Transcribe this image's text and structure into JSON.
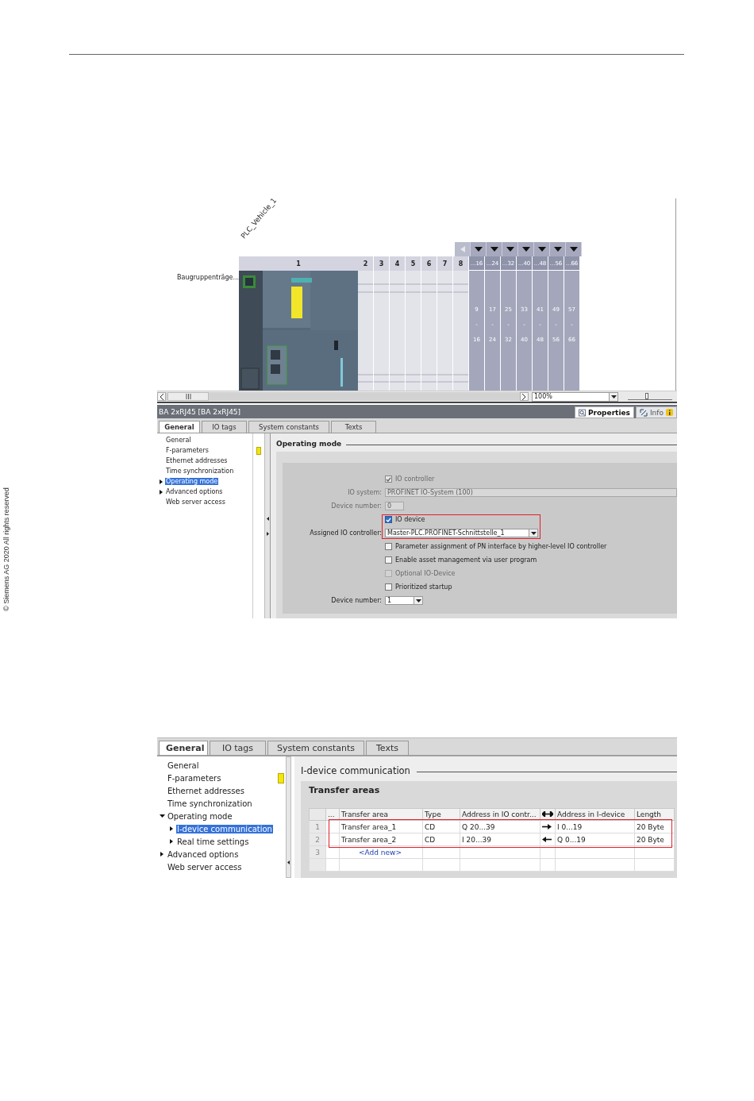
{
  "side_note": "© Siemens AG 2020 All rights reserved",
  "figure_1": {
    "device_view": {
      "device_name": "PLC_Vehicle_1",
      "rack_label": "Baugruppenträge...",
      "slots": [
        "1",
        "2",
        "3",
        "4",
        "5",
        "6",
        "7",
        "8"
      ],
      "extension_columns": [
        {
          "header": "...16",
          "first": "9",
          "separator": "-",
          "last": "16"
        },
        {
          "header": "...24",
          "first": "17",
          "separator": "-",
          "last": "24"
        },
        {
          "header": "...32",
          "first": "25",
          "separator": "-",
          "last": "32"
        },
        {
          "header": "...40",
          "first": "33",
          "separator": "-",
          "last": "40"
        },
        {
          "header": "...48",
          "first": "41",
          "separator": "-",
          "last": "48"
        },
        {
          "header": "...56",
          "first": "49",
          "separator": "-",
          "last": "56"
        },
        {
          "header": "...66",
          "first": "57",
          "separator": "-",
          "last": "66"
        }
      ],
      "zoom": "100%",
      "zoom_slider": {
        "level": 0.42
      }
    },
    "properties": {
      "title": "BA 2xRJ45 [BA 2xRJ45]",
      "inspector_tabs": [
        {
          "label": "Properties",
          "selected": true
        },
        {
          "label": "Info",
          "selected": false
        }
      ],
      "tabs": [
        {
          "label": "General",
          "selected": true
        },
        {
          "label": "IO tags",
          "selected": false
        },
        {
          "label": "System constants",
          "selected": false
        },
        {
          "label": "Texts",
          "selected": false
        }
      ],
      "nav": [
        {
          "label": "General",
          "selected": false,
          "expandable": false,
          "warning": false
        },
        {
          "label": "F-parameters",
          "selected": false,
          "expandable": false,
          "warning": true
        },
        {
          "label": "Ethernet addresses",
          "selected": false,
          "expandable": false,
          "warning": false
        },
        {
          "label": "Time synchronization",
          "selected": false,
          "expandable": false,
          "warning": false
        },
        {
          "label": "Operating mode",
          "selected": true,
          "expandable": true,
          "expanded": false,
          "warning": false
        },
        {
          "label": "Advanced options",
          "selected": false,
          "expandable": true,
          "expanded": false,
          "warning": false
        },
        {
          "label": "Web server access",
          "selected": false,
          "expandable": false,
          "warning": false
        }
      ],
      "section_title": "Operating mode",
      "fields": [
        {
          "kind": "checkbox",
          "label": "IO controller",
          "checked": true,
          "disabled": true,
          "highlighted": false
        },
        {
          "kind": "wide_field",
          "label": "IO system:",
          "value": "PROFINET IO-System (100)",
          "disabled": true,
          "highlighted": false
        },
        {
          "kind": "short_field",
          "label": "Device number:",
          "value": "0",
          "disabled": true,
          "highlighted": false
        },
        {
          "kind": "checkbox",
          "label": "IO device",
          "checked": true,
          "disabled": false,
          "highlighted": true
        },
        {
          "kind": "dropdown",
          "label": "Assigned IO controller:",
          "value": "Master-PLC.PROFINET-Schnittstelle_1",
          "disabled": false,
          "highlighted": true
        },
        {
          "kind": "checkbox",
          "label": "Parameter assignment of PN interface by higher-level IO controller",
          "checked": false,
          "disabled": false,
          "highlighted": false
        },
        {
          "kind": "checkbox",
          "label": "Enable asset management via user program",
          "checked": false,
          "disabled": false,
          "highlighted": false
        },
        {
          "kind": "checkbox",
          "label": "Optional IO-Device",
          "checked": false,
          "disabled": true,
          "highlighted": false
        },
        {
          "kind": "checkbox",
          "label": "Prioritized startup",
          "checked": false,
          "disabled": false,
          "highlighted": false
        },
        {
          "kind": "short_dropdown",
          "label": "Device number:",
          "value": "1",
          "disabled": false,
          "highlighted": false
        }
      ]
    }
  },
  "figure_2": {
    "tabs": [
      {
        "label": "General",
        "selected": true
      },
      {
        "label": "IO tags",
        "selected": false
      },
      {
        "label": "System constants",
        "selected": false
      },
      {
        "label": "Texts",
        "selected": false
      }
    ],
    "nav": [
      {
        "label": "General",
        "selected": false,
        "expandable": false,
        "warning": false
      },
      {
        "label": "F-parameters",
        "selected": false,
        "expandable": false,
        "warning": true
      },
      {
        "label": "Ethernet addresses",
        "selected": false,
        "expandable": false,
        "warning": false
      },
      {
        "label": "Time synchronization",
        "selected": false,
        "expandable": false,
        "warning": false
      },
      {
        "label": "Operating mode",
        "selected": false,
        "expandable": true,
        "expanded": true,
        "warning": false,
        "children": [
          {
            "label": "I-device communication",
            "selected": true,
            "expandable": true,
            "expanded": false,
            "warning": false
          },
          {
            "label": "Real time settings",
            "selected": false,
            "expandable": true,
            "expanded": false,
            "warning": false
          }
        ]
      },
      {
        "label": "Advanced options",
        "selected": false,
        "expandable": true,
        "expanded": false,
        "warning": false
      },
      {
        "label": "Web server access",
        "selected": false,
        "expandable": false,
        "warning": false
      }
    ],
    "section_title": "I-device communication",
    "panel_title": "Transfer areas",
    "table": {
      "columns": [
        {
          "kind": "text",
          "label": "..."
        },
        {
          "kind": "text",
          "label": "Transfer area"
        },
        {
          "kind": "text",
          "label": "Type"
        },
        {
          "kind": "text",
          "label": "Address in IO contr..."
        },
        {
          "kind": "direction"
        },
        {
          "kind": "text",
          "label": "Address in I-device"
        },
        {
          "kind": "text",
          "label": "Length"
        }
      ],
      "rows": [
        {
          "kind": "area",
          "number": "1",
          "name": "Transfer area_1",
          "type": "CD",
          "io_address": "Q 20...39",
          "to_device": true,
          "device_address": "I 0...19",
          "length": "20 Byte",
          "highlighted": true
        },
        {
          "kind": "area",
          "number": "2",
          "name": "Transfer area_2",
          "type": "CD",
          "io_address": "I 20...39",
          "to_device": false,
          "device_address": "Q 0...19",
          "length": "20 Byte",
          "highlighted": true
        },
        {
          "kind": "add",
          "number": "3",
          "add_new": "<Add new>",
          "highlighted": false
        }
      ]
    }
  }
}
